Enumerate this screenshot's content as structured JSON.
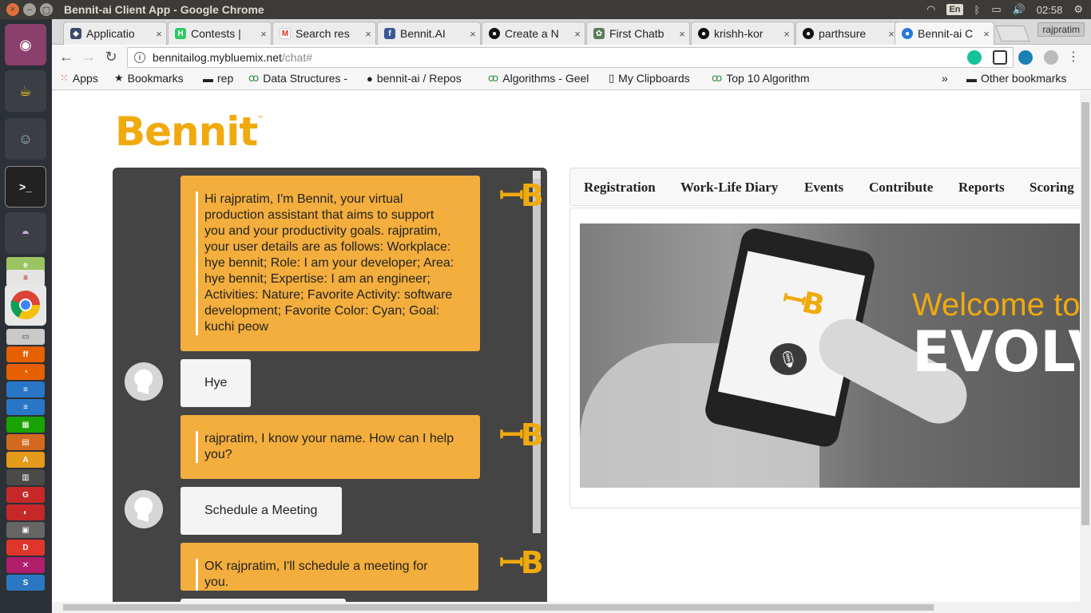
{
  "window": {
    "title": "Bennit-ai Client App - Google Chrome"
  },
  "tray": {
    "lang": "En",
    "time": "02:58"
  },
  "tabs": [
    {
      "label": "Applicatio",
      "close": "×"
    },
    {
      "label": "Contests |",
      "close": "×"
    },
    {
      "label": "Search res",
      "close": "×"
    },
    {
      "label": "Bennit.AI",
      "close": "×"
    },
    {
      "label": "Create a N",
      "close": "×"
    },
    {
      "label": "First Chatb",
      "close": "×"
    },
    {
      "label": "krishh-kor",
      "close": "×"
    },
    {
      "label": "parthsure",
      "close": "×"
    },
    {
      "label": "Bennit-ai C",
      "close": "×"
    }
  ],
  "user_chip": "rajpratim",
  "address": {
    "host": "bennitailog.mybluemix.net",
    "path": "/chat#"
  },
  "bookmarks": [
    {
      "label": "Apps"
    },
    {
      "label": "Bookmarks"
    },
    {
      "label": "rep"
    },
    {
      "label": "Data Structures -"
    },
    {
      "label": "bennit-ai / Repos"
    },
    {
      "label": "Algorithms - Geel"
    },
    {
      "label": "My Clipboards"
    },
    {
      "label": "Top 10 Algorithm"
    },
    {
      "label": "»"
    },
    {
      "label": "Other bookmarks"
    }
  ],
  "page": {
    "logo": "Bennit",
    "logo_tm": "™",
    "chat": [
      {
        "from": "bot",
        "text": "Hi rajpratim, I'm Bennit, your virtual production assistant that aims to support you and your productivity goals. rajpratim, your user details are as follows: Workplace: hye bennit; Role: I am your developer; Area: hye bennit; Expertise: I am an engineer; Activities: Nature; Favorite Activity: software development; Favorite Color: Cyan; Goal: kuchi peow"
      },
      {
        "from": "user",
        "text": "Hye"
      },
      {
        "from": "bot",
        "text": "rajpratim, I know your name. How can I help you?"
      },
      {
        "from": "user",
        "text": "Schedule a Meeting"
      },
      {
        "from": "bot",
        "text": "OK rajpratim, I'll schedule a meeting for you."
      }
    ],
    "bot_logo_glyph": "ꟷB",
    "nav": [
      "Registration",
      "Work-Life Diary",
      "Events",
      "Contribute",
      "Reports",
      "Scoring"
    ],
    "hero": {
      "welcome": "Welcome to",
      "headline": "EVOLVE",
      "phone_logo": "ꟷB",
      "mic": "🎙"
    }
  },
  "launcher_icons": [
    "ubuntu-dash",
    "teapot-app",
    "robot-app",
    "terminal",
    "tor-browser",
    "libreoffice-impress",
    "chrome",
    "drive-app",
    "firefox",
    "writer",
    "calc",
    "impress",
    "software-center",
    "unity-tweak",
    "disk-app",
    "remote-app",
    "font-app",
    "amazon",
    "settings",
    "music"
  ]
}
